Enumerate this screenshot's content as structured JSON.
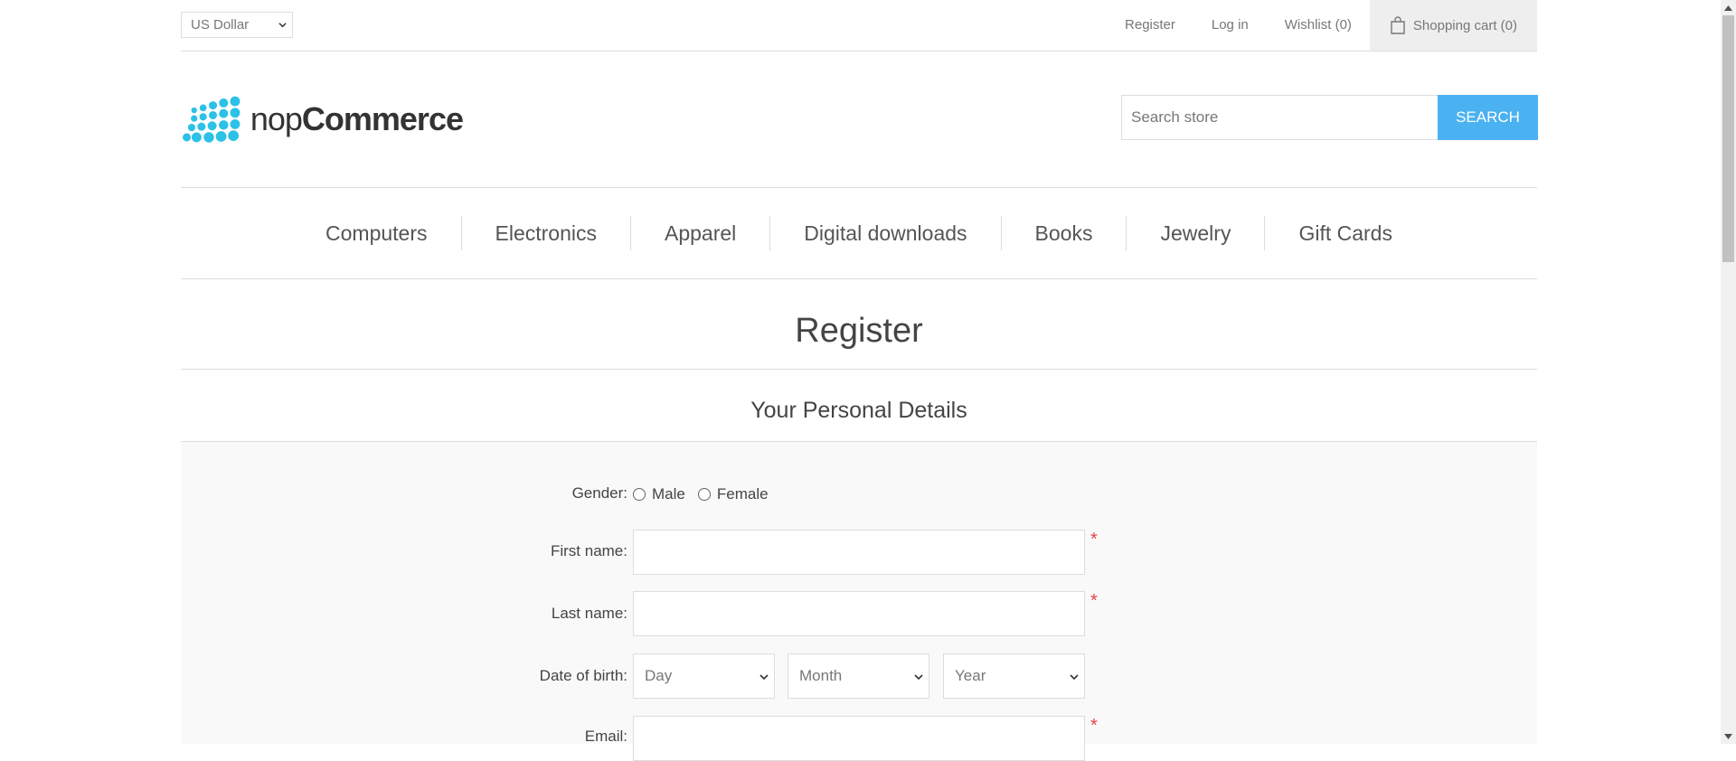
{
  "topbar": {
    "currency": "US Dollar",
    "links": [
      "Register",
      "Log in",
      "Wishlist (0)"
    ],
    "cart": "Shopping cart (0)"
  },
  "header": {
    "logo_light": "nop",
    "logo_bold": "Commerce",
    "search_placeholder": "Search store",
    "search_button": "SEARCH"
  },
  "nav": [
    "Computers",
    "Electronics",
    "Apparel",
    "Digital downloads",
    "Books",
    "Jewelry",
    "Gift Cards"
  ],
  "page_title": "Register",
  "section_title": "Your Personal Details",
  "form": {
    "gender_label": "Gender:",
    "gender_options": [
      "Male",
      "Female"
    ],
    "first_name_label": "First name:",
    "last_name_label": "Last name:",
    "dob_label": "Date of birth:",
    "dob_day": "Day",
    "dob_month": "Month",
    "dob_year": "Year",
    "email_label": "Email:",
    "required_mark": "*"
  },
  "colors": {
    "accent": "#4ab2f1",
    "required": "#e4434b",
    "logo": "#2cc1e6"
  }
}
